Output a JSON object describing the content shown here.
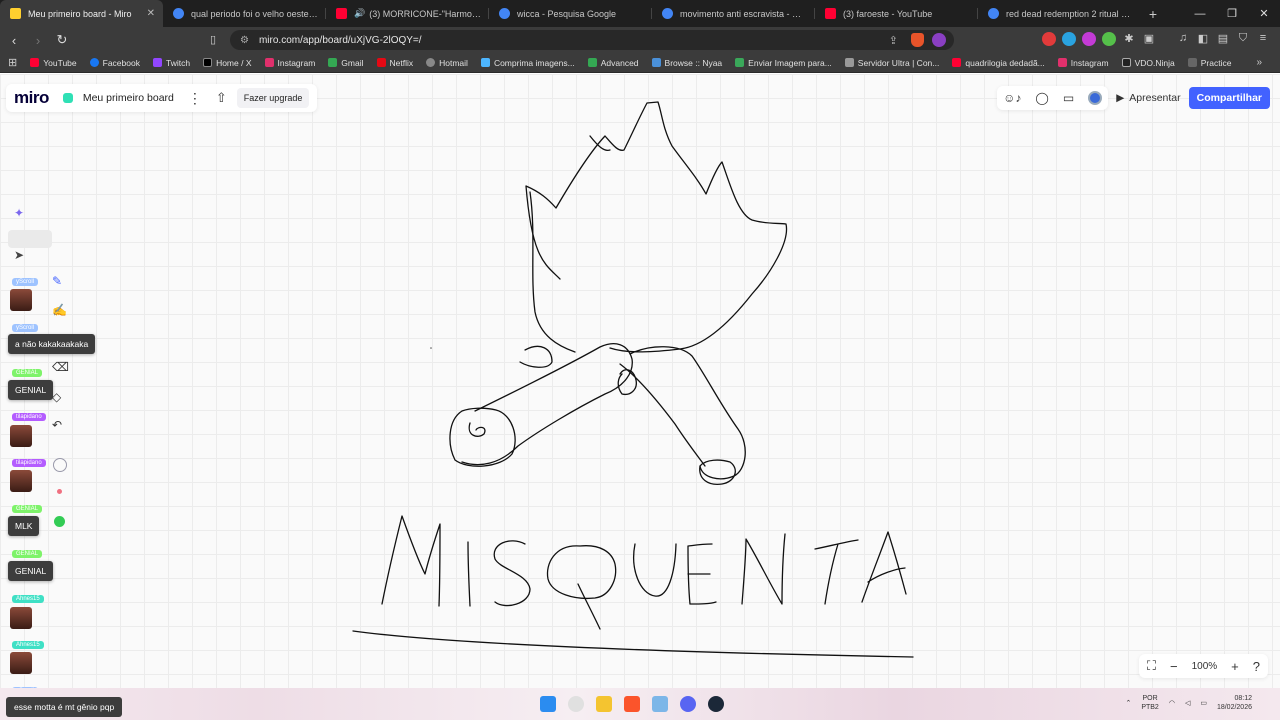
{
  "browser": {
    "tabs": [
      {
        "title": "Meu primeiro board - Miro",
        "favicon_color": "#ffd02f",
        "active": true
      },
      {
        "title": "qual periodo foi o velho oeste - Pesq",
        "favicon_color": "#4285f4",
        "active": false
      },
      {
        "title": "(3) MORRICONE-\"Harmonica/ M",
        "favicon_color": "#ff0033",
        "active": false
      },
      {
        "title": "wicca - Pesquisa Google",
        "favicon_color": "#4285f4",
        "active": false
      },
      {
        "title": "movimento anti escravista - Pesquis",
        "favicon_color": "#4285f4",
        "active": false
      },
      {
        "title": "(3) faroeste - YouTube",
        "favicon_color": "#ff0033",
        "active": false
      },
      {
        "title": "red dead redemption 2 ritual - Pesq",
        "favicon_color": "#4285f4",
        "active": false
      }
    ],
    "new_tab": "+",
    "url": "miro.com/app/board/uXjVG-2lOQY=/",
    "bookmarks": [
      {
        "label": "YouTube",
        "color": "#ff0033"
      },
      {
        "label": "Facebook",
        "color": "#1877f2"
      },
      {
        "label": "Twitch",
        "color": "#9146ff"
      },
      {
        "label": "Home / X",
        "color": "#000000"
      },
      {
        "label": "Instagram",
        "color": "#e1306c"
      },
      {
        "label": "Gmail",
        "color": "#34a853"
      },
      {
        "label": "Netflix",
        "color": "#e50914"
      },
      {
        "label": "Hotmail",
        "color": "#888888"
      },
      {
        "label": "Comprima imagens...",
        "color": "#4db6ff"
      },
      {
        "label": "Advanced",
        "color": "#34a853"
      },
      {
        "label": "Browse :: Nyaa",
        "color": "#4a90d9"
      },
      {
        "label": "Enviar Imagem para...",
        "color": "#3aa85a"
      },
      {
        "label": "Servidor Ultra | Con...",
        "color": "#999999"
      },
      {
        "label": "quadrilogia dedadã...",
        "color": "#ff0033"
      },
      {
        "label": "Instagram",
        "color": "#e1306c"
      },
      {
        "label": "VDO.Ninja",
        "color": "#222222"
      },
      {
        "label": "Practice",
        "color": "#666666"
      }
    ]
  },
  "miro": {
    "logo": "miro",
    "board_name": "Meu primeiro board",
    "upgrade_label": "Fazer upgrade",
    "present_label": "Apresentar",
    "share_label": "Compartilhar",
    "zoom_level": "100%",
    "drawing_text": "MISQUENTA",
    "cursor_tags": [
      {
        "label": "yScroll",
        "color": "#9ec3ff"
      },
      {
        "label": "yScroll",
        "color": "#9ec3ff"
      },
      {
        "label": "GENIAL",
        "color": "#7ef36a"
      },
      {
        "label": "tilapidano",
        "color": "#b45cff"
      },
      {
        "label": "tilapidano",
        "color": "#b45cff"
      },
      {
        "label": "GENIAL",
        "color": "#7ef36a"
      },
      {
        "label": "GENIAL",
        "color": "#7ef36a"
      },
      {
        "label": "Ahnes15",
        "color": "#3fe0c5"
      },
      {
        "label": "Ahnes15",
        "color": "#3fe0c5"
      },
      {
        "label": "yScroll",
        "color": "#9ec3ff"
      }
    ],
    "chat_cards": [
      "a não kakakaakaka",
      "GENIAL",
      "MLK",
      "GENIAL",
      "esse motta é mt gênio pqp"
    ]
  },
  "taskbar": {
    "language": "POR",
    "layout": "PTB2",
    "time": "08:12",
    "date": "18/02/2026"
  }
}
